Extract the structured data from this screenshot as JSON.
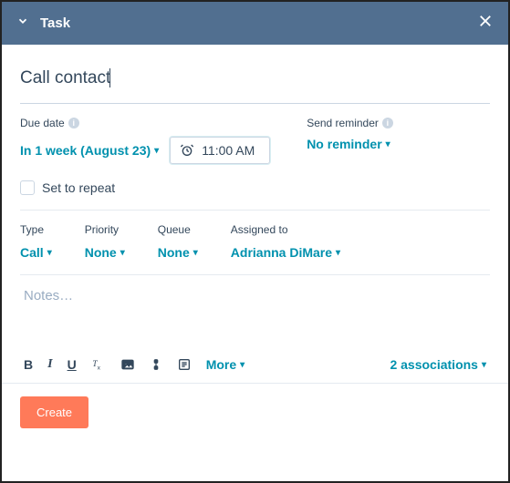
{
  "header": {
    "title": "Task"
  },
  "title_input": {
    "value": "Call contact"
  },
  "due_date": {
    "label": "Due date",
    "value": "In 1 week (August 23)"
  },
  "time": {
    "value": "11:00 AM"
  },
  "send_reminder": {
    "label": "Send reminder",
    "value": "No reminder"
  },
  "repeat": {
    "label": "Set to repeat"
  },
  "type": {
    "label": "Type",
    "value": "Call"
  },
  "priority": {
    "label": "Priority",
    "value": "None"
  },
  "queue": {
    "label": "Queue",
    "value": "None"
  },
  "assigned_to": {
    "label": "Assigned to",
    "value": "Adrianna DiMare"
  },
  "notes": {
    "placeholder": "Notes…"
  },
  "toolbar": {
    "more": "More",
    "associations": "2 associations"
  },
  "footer": {
    "create": "Create"
  }
}
